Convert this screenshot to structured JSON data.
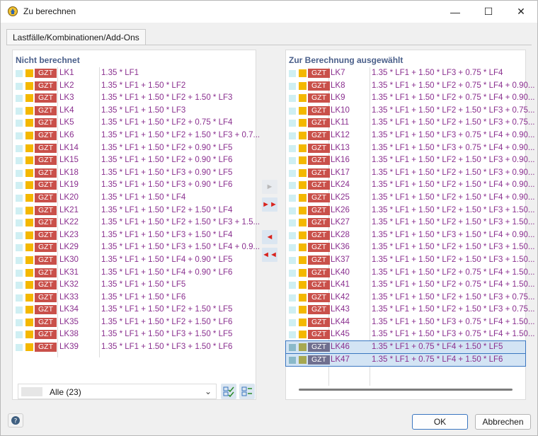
{
  "window": {
    "title": "Zu berechnen",
    "minimize": "—",
    "maximize": "☐",
    "close": "✕"
  },
  "tab": {
    "label": "Lastfälle/Kombinationen/Add-Ons"
  },
  "left": {
    "title": "Nicht berechnet",
    "items": [
      {
        "tag": "GZT",
        "id": "LK1",
        "formula": "1.35 * LF1"
      },
      {
        "tag": "GZT",
        "id": "LK2",
        "formula": "1.35 * LF1 + 1.50 * LF2"
      },
      {
        "tag": "GZT",
        "id": "LK3",
        "formula": "1.35 * LF1 + 1.50 * LF2 + 1.50 * LF3"
      },
      {
        "tag": "GZT",
        "id": "LK4",
        "formula": "1.35 * LF1 + 1.50 * LF3"
      },
      {
        "tag": "GZT",
        "id": "LK5",
        "formula": "1.35 * LF1 + 1.50 * LF2 + 0.75 * LF4"
      },
      {
        "tag": "GZT",
        "id": "LK6",
        "formula": "1.35 * LF1 + 1.50 * LF2 + 1.50 * LF3 + 0.7..."
      },
      {
        "tag": "GZT",
        "id": "LK14",
        "formula": "1.35 * LF1 + 1.50 * LF2 + 0.90 * LF5"
      },
      {
        "tag": "GZT",
        "id": "LK15",
        "formula": "1.35 * LF1 + 1.50 * LF2 + 0.90 * LF6"
      },
      {
        "tag": "GZT",
        "id": "LK18",
        "formula": "1.35 * LF1 + 1.50 * LF3 + 0.90 * LF5"
      },
      {
        "tag": "GZT",
        "id": "LK19",
        "formula": "1.35 * LF1 + 1.50 * LF3 + 0.90 * LF6"
      },
      {
        "tag": "GZT",
        "id": "LK20",
        "formula": "1.35 * LF1 + 1.50 * LF4"
      },
      {
        "tag": "GZT",
        "id": "LK21",
        "formula": "1.35 * LF1 + 1.50 * LF2 + 1.50 * LF4"
      },
      {
        "tag": "GZT",
        "id": "LK22",
        "formula": "1.35 * LF1 + 1.50 * LF2 + 1.50 * LF3 + 1.5..."
      },
      {
        "tag": "GZT",
        "id": "LK23",
        "formula": "1.35 * LF1 + 1.50 * LF3 + 1.50 * LF4"
      },
      {
        "tag": "GZT",
        "id": "LK29",
        "formula": "1.35 * LF1 + 1.50 * LF3 + 1.50 * LF4 + 0.9..."
      },
      {
        "tag": "GZT",
        "id": "LK30",
        "formula": "1.35 * LF1 + 1.50 * LF4 + 0.90 * LF5"
      },
      {
        "tag": "GZT",
        "id": "LK31",
        "formula": "1.35 * LF1 + 1.50 * LF4 + 0.90 * LF6"
      },
      {
        "tag": "GZT",
        "id": "LK32",
        "formula": "1.35 * LF1 + 1.50 * LF5"
      },
      {
        "tag": "GZT",
        "id": "LK33",
        "formula": "1.35 * LF1 + 1.50 * LF6"
      },
      {
        "tag": "GZT",
        "id": "LK34",
        "formula": "1.35 * LF1 + 1.50 * LF2 + 1.50 * LF5"
      },
      {
        "tag": "GZT",
        "id": "LK35",
        "formula": "1.35 * LF1 + 1.50 * LF2 + 1.50 * LF6"
      },
      {
        "tag": "GZT",
        "id": "LK38",
        "formula": "1.35 * LF1 + 1.50 * LF3 + 1.50 * LF5"
      },
      {
        "tag": "GZT",
        "id": "LK39",
        "formula": "1.35 * LF1 + 1.50 * LF3 + 1.50 * LF6"
      }
    ],
    "filter_label": "Alle (23)"
  },
  "right": {
    "title": "Zur Berechnung ausgewählt",
    "items": [
      {
        "tag": "GZT",
        "id": "LK7",
        "formula": "1.35 * LF1 + 1.50 * LF3 + 0.75 * LF4"
      },
      {
        "tag": "GZT",
        "id": "LK8",
        "formula": "1.35 * LF1 + 1.50 * LF2 + 0.75 * LF4 + 0.90..."
      },
      {
        "tag": "GZT",
        "id": "LK9",
        "formula": "1.35 * LF1 + 1.50 * LF2 + 0.75 * LF4 + 0.90..."
      },
      {
        "tag": "GZT",
        "id": "LK10",
        "formula": "1.35 * LF1 + 1.50 * LF2 + 1.50 * LF3 + 0.75..."
      },
      {
        "tag": "GZT",
        "id": "LK11",
        "formula": "1.35 * LF1 + 1.50 * LF2 + 1.50 * LF3 + 0.75..."
      },
      {
        "tag": "GZT",
        "id": "LK12",
        "formula": "1.35 * LF1 + 1.50 * LF3 + 0.75 * LF4 + 0.90..."
      },
      {
        "tag": "GZT",
        "id": "LK13",
        "formula": "1.35 * LF1 + 1.50 * LF3 + 0.75 * LF4 + 0.90..."
      },
      {
        "tag": "GZT",
        "id": "LK16",
        "formula": "1.35 * LF1 + 1.50 * LF2 + 1.50 * LF3 + 0.90..."
      },
      {
        "tag": "GZT",
        "id": "LK17",
        "formula": "1.35 * LF1 + 1.50 * LF2 + 1.50 * LF3 + 0.90..."
      },
      {
        "tag": "GZT",
        "id": "LK24",
        "formula": "1.35 * LF1 + 1.50 * LF2 + 1.50 * LF4 + 0.90..."
      },
      {
        "tag": "GZT",
        "id": "LK25",
        "formula": "1.35 * LF1 + 1.50 * LF2 + 1.50 * LF4 + 0.90..."
      },
      {
        "tag": "GZT",
        "id": "LK26",
        "formula": "1.35 * LF1 + 1.50 * LF2 + 1.50 * LF3 + 1.50..."
      },
      {
        "tag": "GZT",
        "id": "LK27",
        "formula": "1.35 * LF1 + 1.50 * LF2 + 1.50 * LF3 + 1.50..."
      },
      {
        "tag": "GZT",
        "id": "LK28",
        "formula": "1.35 * LF1 + 1.50 * LF3 + 1.50 * LF4 + 0.90..."
      },
      {
        "tag": "GZT",
        "id": "LK36",
        "formula": "1.35 * LF1 + 1.50 * LF2 + 1.50 * LF3 + 1.50..."
      },
      {
        "tag": "GZT",
        "id": "LK37",
        "formula": "1.35 * LF1 + 1.50 * LF2 + 1.50 * LF3 + 1.50..."
      },
      {
        "tag": "GZT",
        "id": "LK40",
        "formula": "1.35 * LF1 + 1.50 * LF2 + 0.75 * LF4 + 1.50..."
      },
      {
        "tag": "GZT",
        "id": "LK41",
        "formula": "1.35 * LF1 + 1.50 * LF2 + 0.75 * LF4 + 1.50..."
      },
      {
        "tag": "GZT",
        "id": "LK42",
        "formula": "1.35 * LF1 + 1.50 * LF2 + 1.50 * LF3 + 0.75..."
      },
      {
        "tag": "GZT",
        "id": "LK43",
        "formula": "1.35 * LF1 + 1.50 * LF2 + 1.50 * LF3 + 0.75..."
      },
      {
        "tag": "GZT",
        "id": "LK44",
        "formula": "1.35 * LF1 + 1.50 * LF3 + 0.75 * LF4 + 1.50..."
      },
      {
        "tag": "GZT",
        "id": "LK45",
        "formula": "1.35 * LF1 + 1.50 * LF3 + 0.75 * LF4 + 1.50..."
      },
      {
        "tag": "GZT",
        "id": "LK46",
        "formula": "1.35 * LF1 + 0.75 * LF4 + 1.50 * LF5",
        "selected": true
      },
      {
        "tag": "GZT",
        "id": "LK47",
        "formula": "1.35 * LF1 + 0.75 * LF4 + 1.50 * LF6",
        "selected": true
      }
    ]
  },
  "buttons": {
    "ok": "OK",
    "cancel": "Abbrechen"
  },
  "icons": {
    "move_right": "move-right-icon",
    "move_all_right": "move-all-right-icon",
    "move_left": "move-left-icon",
    "move_all_left": "move-all-left-icon",
    "help": "help-icon"
  },
  "colors": {
    "tag_bg": "#c9504a",
    "text_purple": "#8a2f8f",
    "title_blue": "#4a5f8a",
    "accent": "#3a76c0"
  }
}
